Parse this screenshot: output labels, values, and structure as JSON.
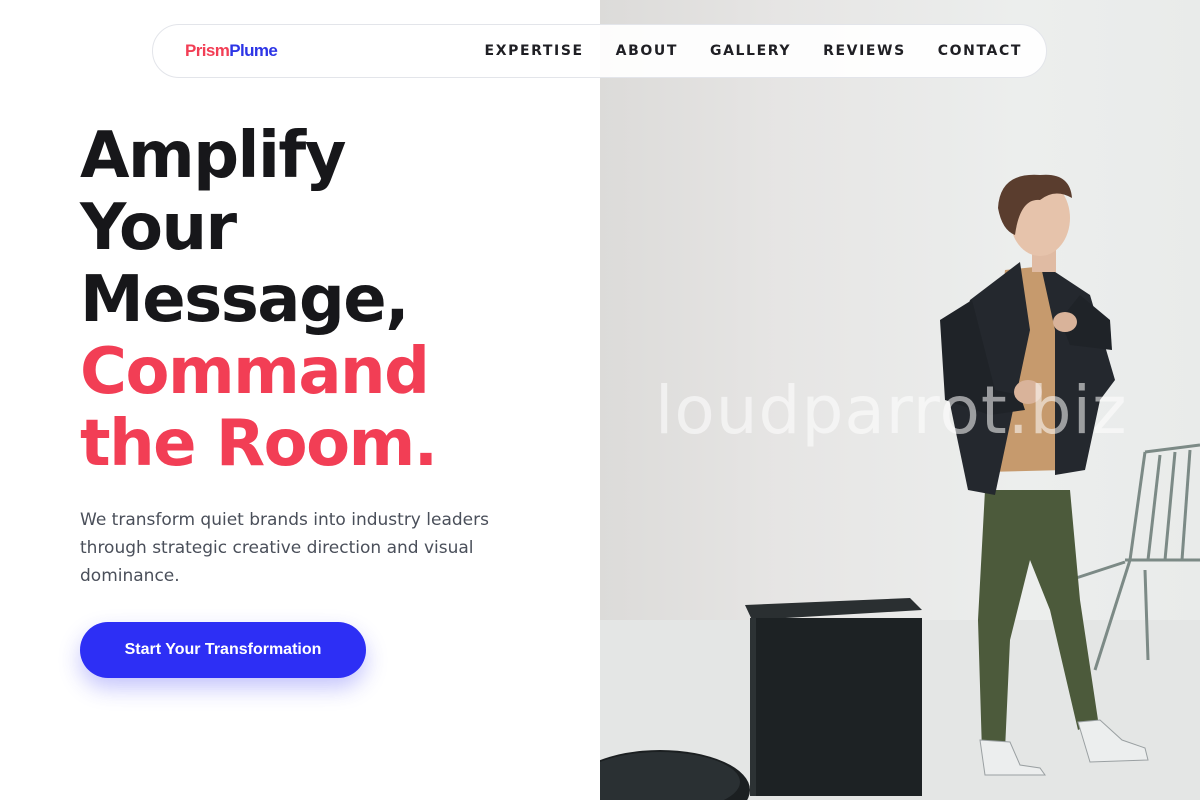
{
  "brand": {
    "part1": "Prism",
    "part2": "Plume"
  },
  "nav": {
    "items": [
      "EXPERTISE",
      "ABOUT",
      "GALLERY",
      "REVIEWS",
      "CONTACT"
    ]
  },
  "hero": {
    "title_lines": [
      "Amplify",
      "Your",
      "Message,"
    ],
    "title_accent_lines": [
      "Command",
      "the Room."
    ],
    "subtitle": "We transform quiet brands into industry leaders through strategic creative direction and visual dominance.",
    "cta_label": "Start Your Transformation"
  },
  "photo": {
    "watermark": "loudparrot.biz"
  },
  "colors": {
    "accent_red": "#f23e55",
    "accent_blue": "#2d2ff5",
    "heading": "#17171a",
    "body_text": "#4a4f5a"
  }
}
